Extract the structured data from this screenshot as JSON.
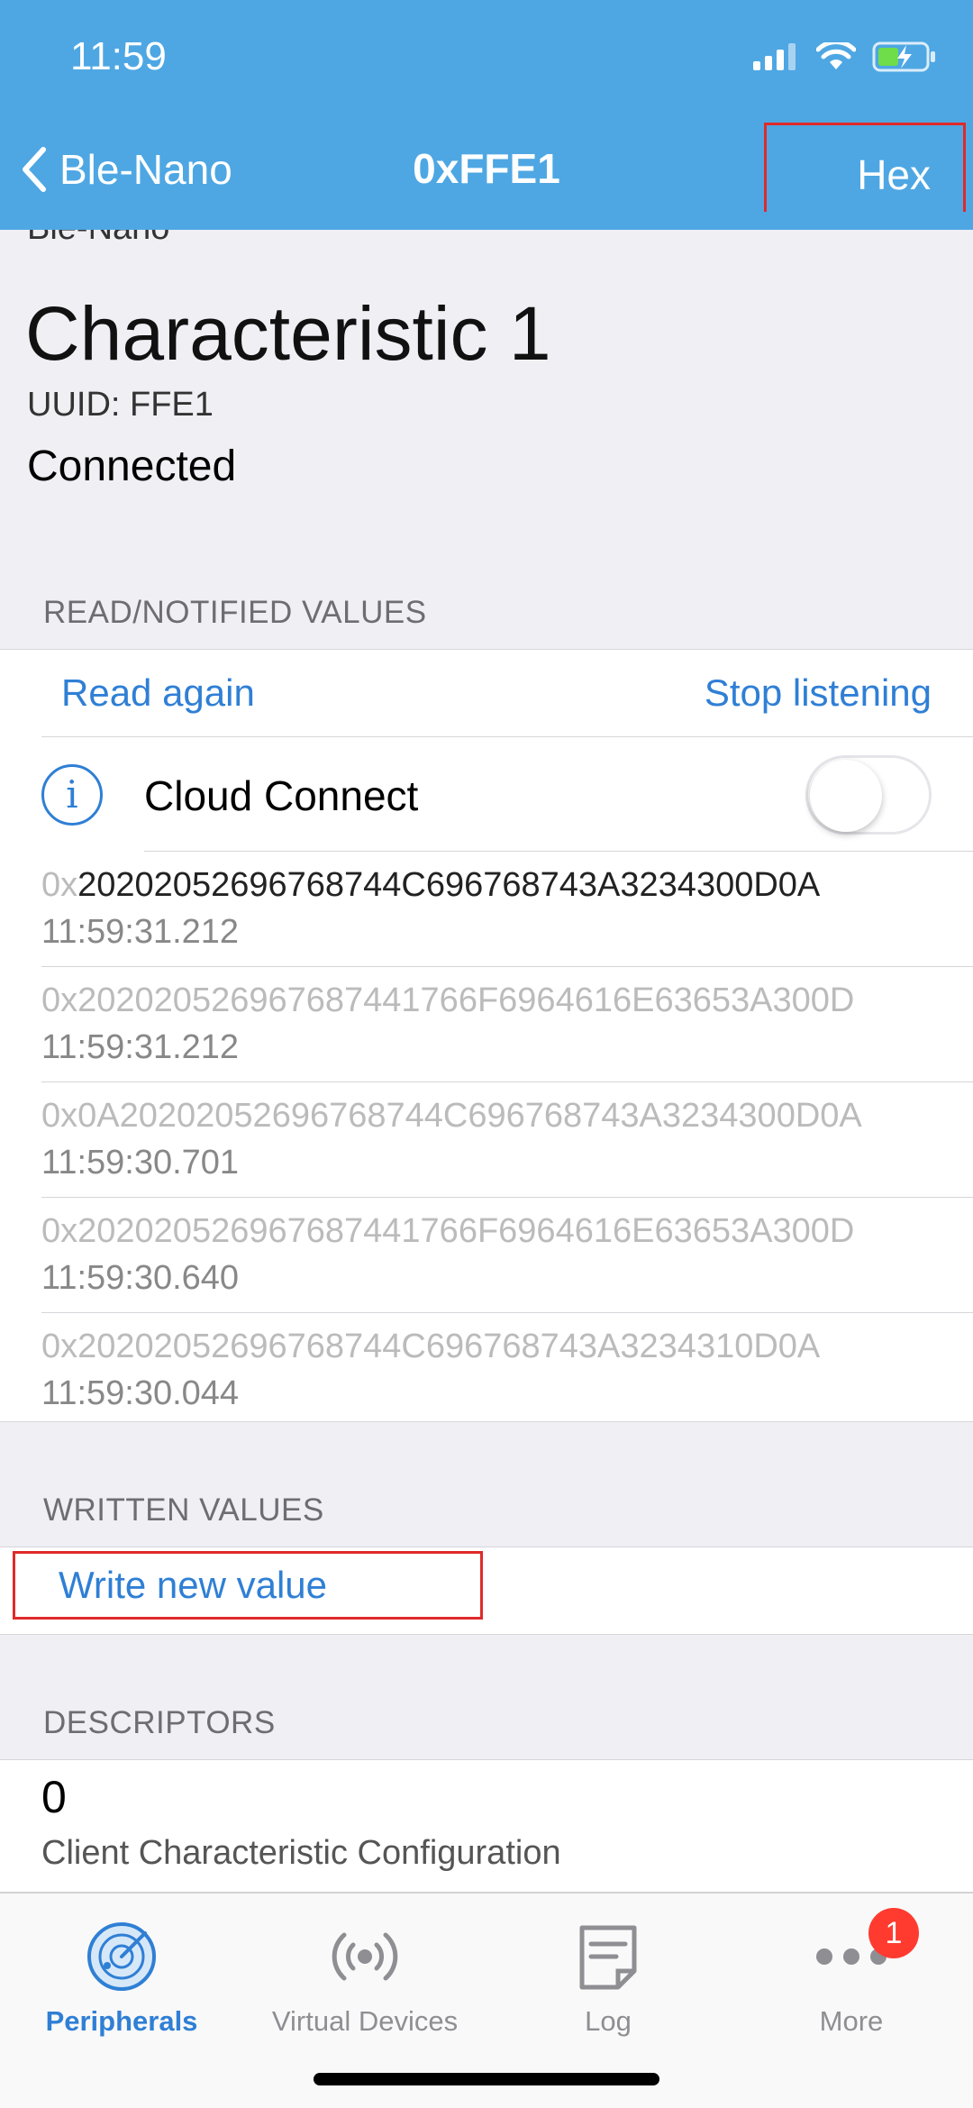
{
  "status": {
    "time": "11:59"
  },
  "nav": {
    "back_label": "Ble-Nano",
    "title": "0xFFE1",
    "hex_label": "Hex"
  },
  "characteristic": {
    "peripheral": "Ble-Nano",
    "title": "Characteristic 1",
    "uuid": "UUID: FFE1",
    "state": "Connected"
  },
  "read_section": {
    "header": "READ/NOTIFIED VALUES",
    "read_again": "Read again",
    "stop_listening": "Stop listening",
    "cloud_connect": "Cloud Connect",
    "cloud_connect_on": false,
    "values": [
      {
        "prefix": "0x",
        "hex": "20202052696768744C696768743A3234300D0A",
        "time": "11:59:31.212",
        "emphasized": true
      },
      {
        "prefix": "0x",
        "hex": "202020526967687441766F6964616E63653A300D",
        "time": "11:59:31.212",
        "emphasized": false
      },
      {
        "prefix": "0x",
        "hex": "0A20202052696768744C696768743A3234300D0A",
        "time": "11:59:30.701",
        "emphasized": false
      },
      {
        "prefix": "0x",
        "hex": "202020526967687441766F6964616E63653A300D",
        "time": "11:59:30.640",
        "emphasized": false
      },
      {
        "prefix": "0x",
        "hex": "20202052696768744C696768743A3234310D0A",
        "time": "11:59:30.044",
        "emphasized": false
      }
    ]
  },
  "written_section": {
    "header": "WRITTEN VALUES",
    "write_new": "Write new value"
  },
  "descriptors_section": {
    "header": "DESCRIPTORS",
    "items": [
      {
        "value": "0",
        "label": "Client Characteristic Configuration"
      }
    ]
  },
  "tabbar": {
    "tabs": [
      {
        "label": "Peripherals",
        "icon": "radar-icon",
        "active": true
      },
      {
        "label": "Virtual Devices",
        "icon": "broadcast-icon",
        "active": false
      },
      {
        "label": "Log",
        "icon": "log-icon",
        "active": false
      },
      {
        "label": "More",
        "icon": "more-icon",
        "active": false,
        "badge": "1"
      }
    ]
  },
  "colors": {
    "header": "#4ea7e3",
    "link": "#2f7fd5",
    "highlight_border": "#e02a2a",
    "badge": "#ff3b30"
  }
}
